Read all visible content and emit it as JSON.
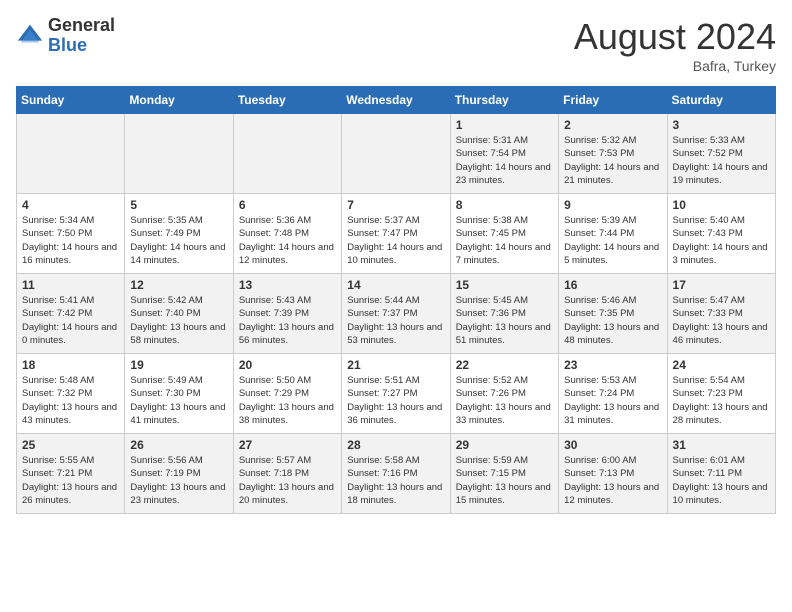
{
  "logo": {
    "general": "General",
    "blue": "Blue"
  },
  "title": {
    "month_year": "August 2024",
    "location": "Bafra, Turkey"
  },
  "weekdays": [
    "Sunday",
    "Monday",
    "Tuesday",
    "Wednesday",
    "Thursday",
    "Friday",
    "Saturday"
  ],
  "weeks": [
    [
      {
        "day": "",
        "sunrise": "",
        "sunset": "",
        "daylight": ""
      },
      {
        "day": "",
        "sunrise": "",
        "sunset": "",
        "daylight": ""
      },
      {
        "day": "",
        "sunrise": "",
        "sunset": "",
        "daylight": ""
      },
      {
        "day": "",
        "sunrise": "",
        "sunset": "",
        "daylight": ""
      },
      {
        "day": "1",
        "sunrise": "Sunrise: 5:31 AM",
        "sunset": "Sunset: 7:54 PM",
        "daylight": "Daylight: 14 hours and 23 minutes."
      },
      {
        "day": "2",
        "sunrise": "Sunrise: 5:32 AM",
        "sunset": "Sunset: 7:53 PM",
        "daylight": "Daylight: 14 hours and 21 minutes."
      },
      {
        "day": "3",
        "sunrise": "Sunrise: 5:33 AM",
        "sunset": "Sunset: 7:52 PM",
        "daylight": "Daylight: 14 hours and 19 minutes."
      }
    ],
    [
      {
        "day": "4",
        "sunrise": "Sunrise: 5:34 AM",
        "sunset": "Sunset: 7:50 PM",
        "daylight": "Daylight: 14 hours and 16 minutes."
      },
      {
        "day": "5",
        "sunrise": "Sunrise: 5:35 AM",
        "sunset": "Sunset: 7:49 PM",
        "daylight": "Daylight: 14 hours and 14 minutes."
      },
      {
        "day": "6",
        "sunrise": "Sunrise: 5:36 AM",
        "sunset": "Sunset: 7:48 PM",
        "daylight": "Daylight: 14 hours and 12 minutes."
      },
      {
        "day": "7",
        "sunrise": "Sunrise: 5:37 AM",
        "sunset": "Sunset: 7:47 PM",
        "daylight": "Daylight: 14 hours and 10 minutes."
      },
      {
        "day": "8",
        "sunrise": "Sunrise: 5:38 AM",
        "sunset": "Sunset: 7:45 PM",
        "daylight": "Daylight: 14 hours and 7 minutes."
      },
      {
        "day": "9",
        "sunrise": "Sunrise: 5:39 AM",
        "sunset": "Sunset: 7:44 PM",
        "daylight": "Daylight: 14 hours and 5 minutes."
      },
      {
        "day": "10",
        "sunrise": "Sunrise: 5:40 AM",
        "sunset": "Sunset: 7:43 PM",
        "daylight": "Daylight: 14 hours and 3 minutes."
      }
    ],
    [
      {
        "day": "11",
        "sunrise": "Sunrise: 5:41 AM",
        "sunset": "Sunset: 7:42 PM",
        "daylight": "Daylight: 14 hours and 0 minutes."
      },
      {
        "day": "12",
        "sunrise": "Sunrise: 5:42 AM",
        "sunset": "Sunset: 7:40 PM",
        "daylight": "Daylight: 13 hours and 58 minutes."
      },
      {
        "day": "13",
        "sunrise": "Sunrise: 5:43 AM",
        "sunset": "Sunset: 7:39 PM",
        "daylight": "Daylight: 13 hours and 56 minutes."
      },
      {
        "day": "14",
        "sunrise": "Sunrise: 5:44 AM",
        "sunset": "Sunset: 7:37 PM",
        "daylight": "Daylight: 13 hours and 53 minutes."
      },
      {
        "day": "15",
        "sunrise": "Sunrise: 5:45 AM",
        "sunset": "Sunset: 7:36 PM",
        "daylight": "Daylight: 13 hours and 51 minutes."
      },
      {
        "day": "16",
        "sunrise": "Sunrise: 5:46 AM",
        "sunset": "Sunset: 7:35 PM",
        "daylight": "Daylight: 13 hours and 48 minutes."
      },
      {
        "day": "17",
        "sunrise": "Sunrise: 5:47 AM",
        "sunset": "Sunset: 7:33 PM",
        "daylight": "Daylight: 13 hours and 46 minutes."
      }
    ],
    [
      {
        "day": "18",
        "sunrise": "Sunrise: 5:48 AM",
        "sunset": "Sunset: 7:32 PM",
        "daylight": "Daylight: 13 hours and 43 minutes."
      },
      {
        "day": "19",
        "sunrise": "Sunrise: 5:49 AM",
        "sunset": "Sunset: 7:30 PM",
        "daylight": "Daylight: 13 hours and 41 minutes."
      },
      {
        "day": "20",
        "sunrise": "Sunrise: 5:50 AM",
        "sunset": "Sunset: 7:29 PM",
        "daylight": "Daylight: 13 hours and 38 minutes."
      },
      {
        "day": "21",
        "sunrise": "Sunrise: 5:51 AM",
        "sunset": "Sunset: 7:27 PM",
        "daylight": "Daylight: 13 hours and 36 minutes."
      },
      {
        "day": "22",
        "sunrise": "Sunrise: 5:52 AM",
        "sunset": "Sunset: 7:26 PM",
        "daylight": "Daylight: 13 hours and 33 minutes."
      },
      {
        "day": "23",
        "sunrise": "Sunrise: 5:53 AM",
        "sunset": "Sunset: 7:24 PM",
        "daylight": "Daylight: 13 hours and 31 minutes."
      },
      {
        "day": "24",
        "sunrise": "Sunrise: 5:54 AM",
        "sunset": "Sunset: 7:23 PM",
        "daylight": "Daylight: 13 hours and 28 minutes."
      }
    ],
    [
      {
        "day": "25",
        "sunrise": "Sunrise: 5:55 AM",
        "sunset": "Sunset: 7:21 PM",
        "daylight": "Daylight: 13 hours and 26 minutes."
      },
      {
        "day": "26",
        "sunrise": "Sunrise: 5:56 AM",
        "sunset": "Sunset: 7:19 PM",
        "daylight": "Daylight: 13 hours and 23 minutes."
      },
      {
        "day": "27",
        "sunrise": "Sunrise: 5:57 AM",
        "sunset": "Sunset: 7:18 PM",
        "daylight": "Daylight: 13 hours and 20 minutes."
      },
      {
        "day": "28",
        "sunrise": "Sunrise: 5:58 AM",
        "sunset": "Sunset: 7:16 PM",
        "daylight": "Daylight: 13 hours and 18 minutes."
      },
      {
        "day": "29",
        "sunrise": "Sunrise: 5:59 AM",
        "sunset": "Sunset: 7:15 PM",
        "daylight": "Daylight: 13 hours and 15 minutes."
      },
      {
        "day": "30",
        "sunrise": "Sunrise: 6:00 AM",
        "sunset": "Sunset: 7:13 PM",
        "daylight": "Daylight: 13 hours and 12 minutes."
      },
      {
        "day": "31",
        "sunrise": "Sunrise: 6:01 AM",
        "sunset": "Sunset: 7:11 PM",
        "daylight": "Daylight: 13 hours and 10 minutes."
      }
    ]
  ]
}
